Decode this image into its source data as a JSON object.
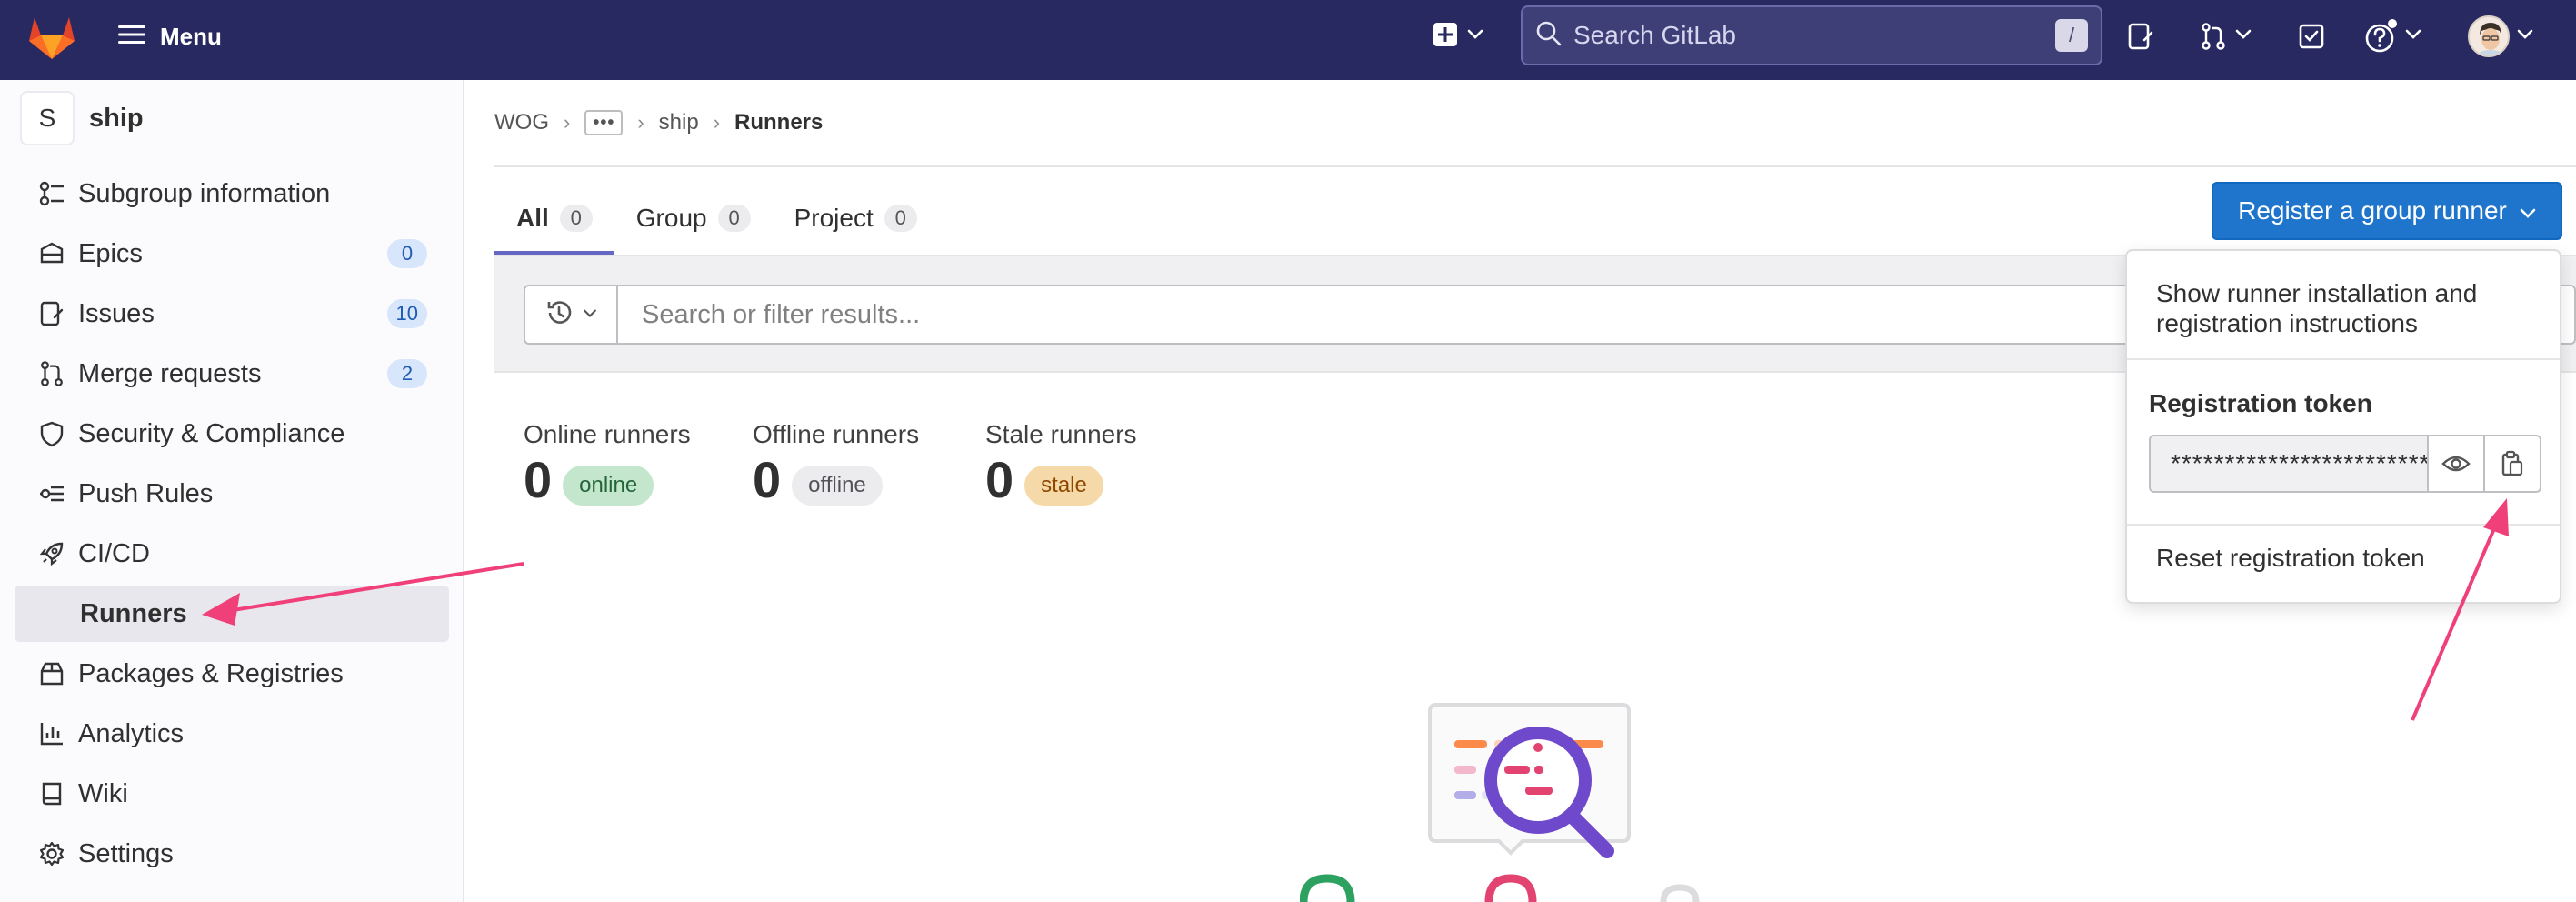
{
  "topbar": {
    "menu_label": "Menu",
    "search_placeholder": "Search GitLab",
    "search_shortcut": "/"
  },
  "sidebar": {
    "group_initial": "S",
    "group_name": "ship",
    "items": [
      {
        "label": "Subgroup information"
      },
      {
        "label": "Epics",
        "badge": "0"
      },
      {
        "label": "Issues",
        "badge": "10"
      },
      {
        "label": "Merge requests",
        "badge": "2"
      },
      {
        "label": "Security & Compliance"
      },
      {
        "label": "Push Rules"
      },
      {
        "label": "CI/CD"
      },
      {
        "label": "Runners"
      },
      {
        "label": "Packages & Registries"
      },
      {
        "label": "Analytics"
      },
      {
        "label": "Wiki"
      },
      {
        "label": "Settings"
      }
    ]
  },
  "breadcrumb": {
    "root": "WOG",
    "dots": "•••",
    "group": "ship",
    "current": "Runners",
    "sep": "›"
  },
  "tabs": [
    {
      "label": "All",
      "count": "0"
    },
    {
      "label": "Group",
      "count": "0"
    },
    {
      "label": "Project",
      "count": "0"
    }
  ],
  "register_button": {
    "label": "Register a group runner"
  },
  "filter": {
    "placeholder": "Search or filter results..."
  },
  "stats": {
    "online": {
      "label": "Online runners",
      "value": "0",
      "badge": "online"
    },
    "offline": {
      "label": "Offline runners",
      "value": "0",
      "badge": "offline"
    },
    "stale": {
      "label": "Stale runners",
      "value": "0",
      "badge": "stale"
    }
  },
  "dropdown": {
    "install_instructions": "Show runner installation and registration instructions",
    "token_title": "Registration token",
    "token_masked": "**************************",
    "reset_label": "Reset registration token"
  },
  "colors": {
    "topbar": "#292961",
    "accent": "#1f75cb",
    "annotation": "#f0407a",
    "online_badge_bg": "#c3e6cd",
    "online_badge_text": "#24663b",
    "offline_badge_bg": "#ececef",
    "offline_badge_text": "#535158",
    "stale_badge_bg": "#f5d9a8",
    "stale_badge_text": "#8f4700"
  },
  "icons": [
    "gitlab-logo",
    "hamburger-icon",
    "plus-square-icon",
    "search-icon",
    "issues-icon",
    "merge-request-icon",
    "todo-icon",
    "help-icon",
    "history-icon",
    "eye-icon",
    "copy-clipboard-icon"
  ]
}
